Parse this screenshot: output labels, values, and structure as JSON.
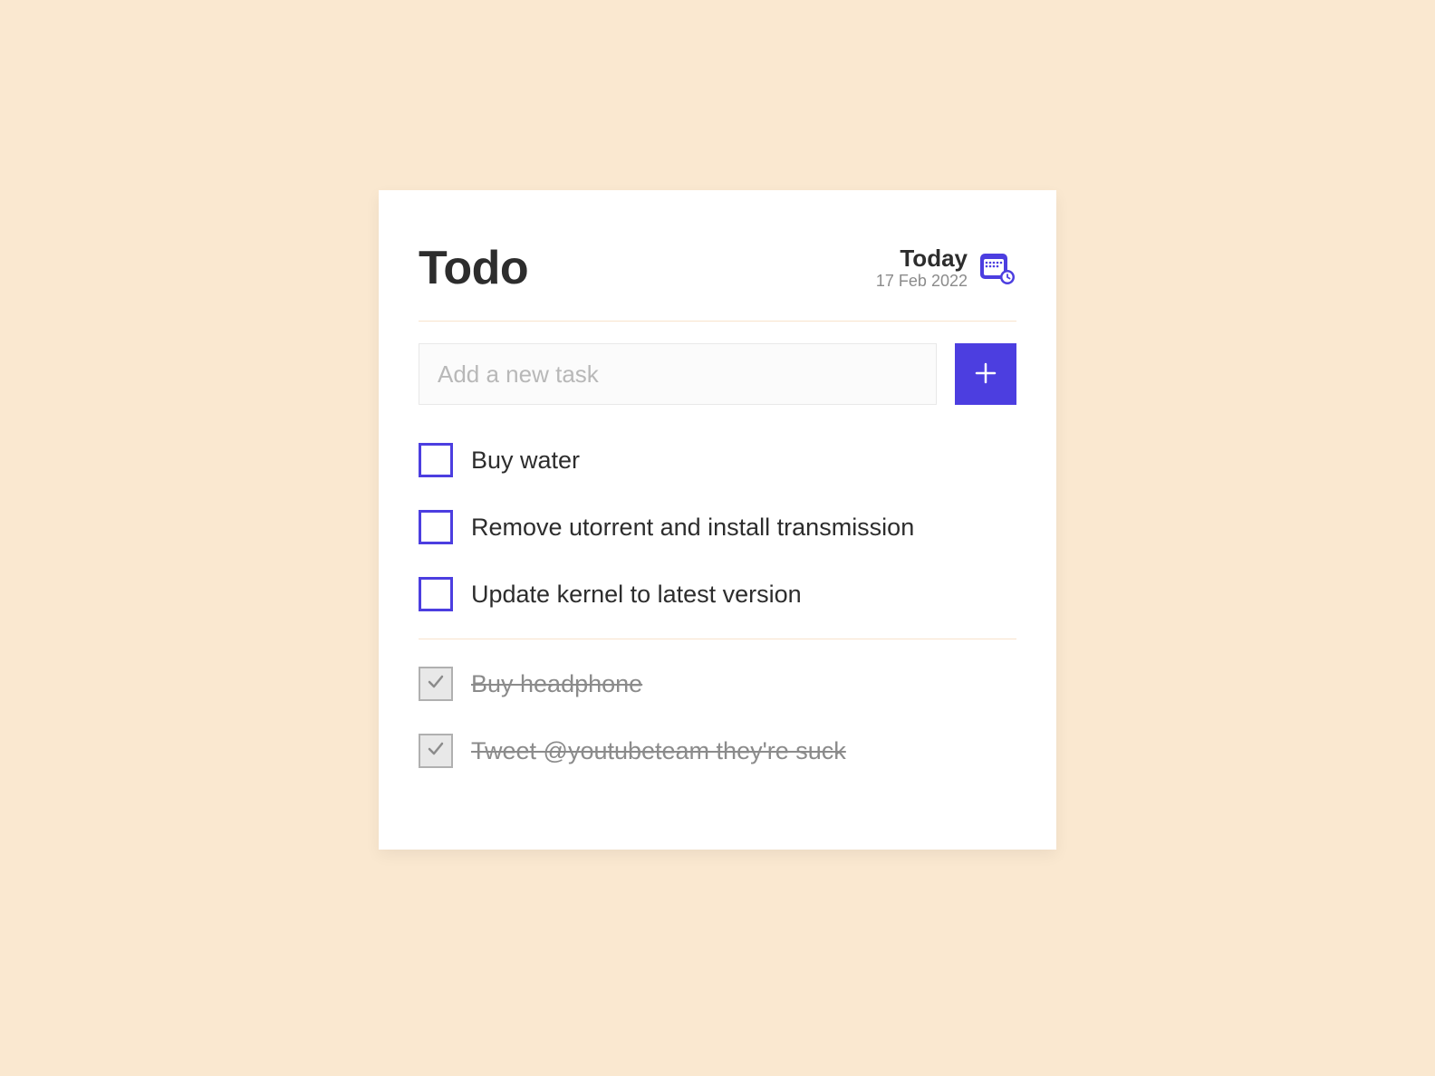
{
  "header": {
    "title": "Todo",
    "today_label": "Today",
    "date": "17 Feb 2022"
  },
  "input": {
    "placeholder": "Add a new task"
  },
  "colors": {
    "accent": "#4c3ee0",
    "background": "#fae8d0"
  },
  "tasks_active": [
    {
      "label": "Buy water"
    },
    {
      "label": "Remove utorrent and install transmission"
    },
    {
      "label": "Update kernel to latest version"
    }
  ],
  "tasks_done": [
    {
      "label": "Buy headphone"
    },
    {
      "label": "Tweet @youtubeteam they're suck"
    }
  ]
}
